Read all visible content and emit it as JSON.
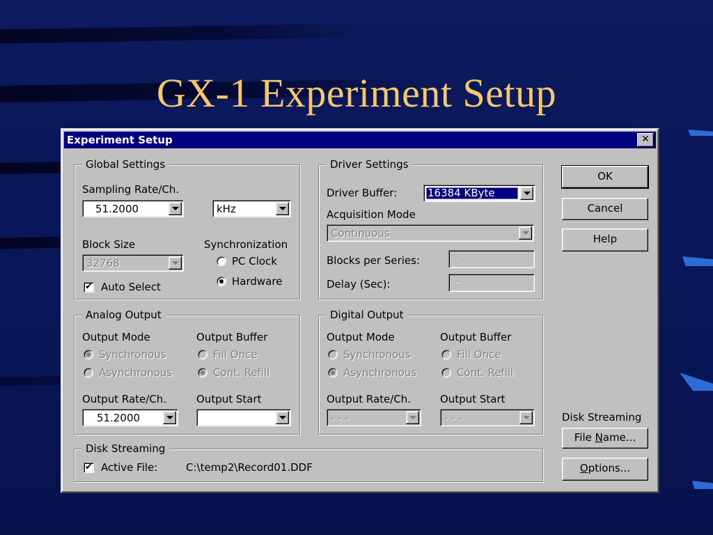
{
  "slide": {
    "title": "GX-1 Experiment Setup"
  },
  "dialog": {
    "title": "Experiment Setup",
    "close_label": "✕"
  },
  "global_settings": {
    "legend": "Global Settings",
    "sampling_rate_label": "Sampling Rate/Ch.",
    "sampling_rate_value": "51.2000",
    "sampling_unit_value": "kHz",
    "block_size_label": "Block Size",
    "block_size_value": "32768",
    "auto_select_label": "Auto Select",
    "auto_select_checked": true,
    "synchronization_label": "Synchronization",
    "sync_options": [
      {
        "label": "PC Clock",
        "selected": false
      },
      {
        "label": "Hardware",
        "selected": true
      }
    ]
  },
  "driver_settings": {
    "legend": "Driver Settings",
    "driver_buffer_label": "Driver Buffer:",
    "driver_buffer_value": "16384 KByte",
    "acquisition_mode_label": "Acquisition Mode",
    "acquisition_mode_value": "Continuous",
    "blocks_per_series_label": "Blocks per Series:",
    "blocks_per_series_value": "-",
    "delay_label": "Delay (Sec):",
    "delay_value": "-"
  },
  "analog_output": {
    "legend": "Analog Output",
    "output_mode_label": "Output Mode",
    "output_mode_options": [
      {
        "label": "Synchronous",
        "selected": true
      },
      {
        "label": "Asynchronous",
        "selected": false
      }
    ],
    "output_buffer_label": "Output Buffer",
    "output_buffer_options": [
      {
        "label": "Fill Once",
        "selected": false
      },
      {
        "label": "Cont. Refill",
        "selected": true
      }
    ],
    "output_rate_label": "Output Rate/Ch.",
    "output_rate_value": "51.2000",
    "output_start_label": "Output Start",
    "output_start_value": ""
  },
  "digital_output": {
    "legend": "Digital Output",
    "output_mode_label": "Output Mode",
    "output_mode_options": [
      {
        "label": "Synchronous",
        "selected": false
      },
      {
        "label": "Asynchronous",
        "selected": true
      }
    ],
    "output_buffer_label": "Output Buffer",
    "output_buffer_options": [
      {
        "label": "Fill Once",
        "selected": false
      },
      {
        "label": "Cont. Refill",
        "selected": false
      }
    ],
    "output_rate_label": "Output Rate/Ch.",
    "output_rate_value": "- - -",
    "output_start_label": "Output Start",
    "output_start_value": "- - -"
  },
  "disk_streaming": {
    "legend": "Disk Streaming",
    "active_file_label": "Active File:",
    "active_file_checked": true,
    "file_path": "C:\\temp2\\Record01.DDF",
    "side_label": "Disk Streaming"
  },
  "buttons": {
    "ok": "OK",
    "cancel": "Cancel",
    "help": "Help",
    "file_name_prefix": "File ",
    "file_name_mnemonic": "N",
    "file_name_suffix": "ame...",
    "options_mnemonic": "O",
    "options_suffix": "ptions..."
  },
  "colors": {
    "slide_background": "#0a185a",
    "title_gold": "#f6c86b",
    "titlebar": "#000080",
    "dialog_face": "#c0c0c0",
    "wedge_accent": "#2d6bd6"
  },
  "icons": {
    "check_glyph": "✔"
  }
}
